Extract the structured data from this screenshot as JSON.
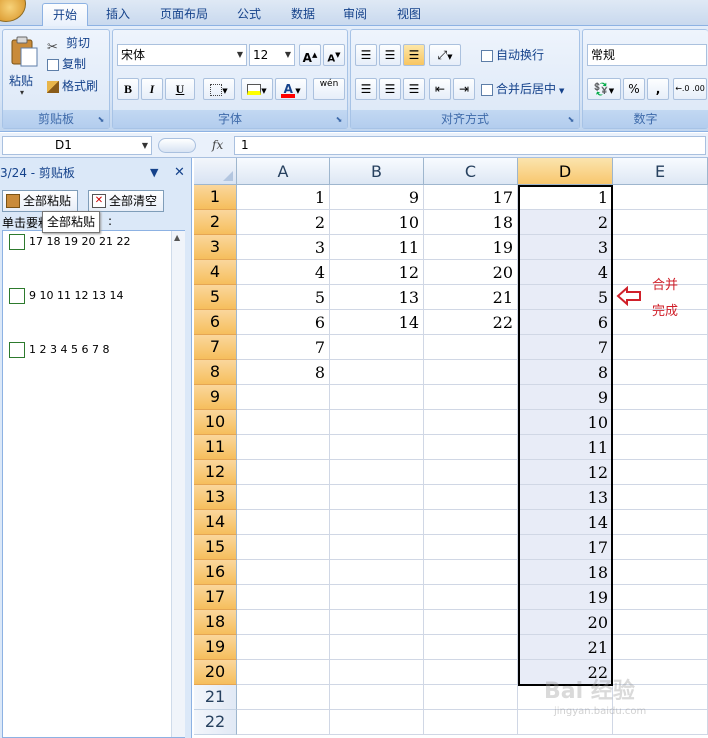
{
  "tabs": [
    {
      "label": "开始",
      "active": true
    },
    {
      "label": "插入"
    },
    {
      "label": "页面布局"
    },
    {
      "label": "公式"
    },
    {
      "label": "数据"
    },
    {
      "label": "审阅"
    },
    {
      "label": "视图"
    }
  ],
  "ribbon": {
    "clipboard": {
      "paste": "粘贴",
      "cut": "剪切",
      "copy": "复制",
      "format_painter": "格式刷",
      "label": "剪贴板"
    },
    "font": {
      "name": "宋体",
      "size": "12",
      "bold": "B",
      "italic": "I",
      "underline": "U",
      "grow": "A",
      "shrink": "A",
      "label": "字体",
      "phonetic": "wén"
    },
    "alignment": {
      "wrap": "自动换行",
      "merge": "合并后居中",
      "label": "对齐方式"
    },
    "number": {
      "format": "常规",
      "percent": "%",
      "comma": ",",
      "label": "数字"
    }
  },
  "formula_bar": {
    "name_box": "D1",
    "fx": "fx",
    "value": "1"
  },
  "clipboard_pane": {
    "title": "3/24 - 剪贴板",
    "paste_all": "全部粘贴",
    "clear_all": "全部清空",
    "hint": "单击要粘",
    "hint_end": ":",
    "tooltip": "全部粘贴",
    "items": [
      "17 18 19 20 21 22",
      "9 10 11 12 13 14",
      "1 2 3 4 5 6 7 8"
    ]
  },
  "grid": {
    "columns": [
      "A",
      "B",
      "C",
      "D",
      "E"
    ],
    "selected_column": "D",
    "rows": [
      {
        "n": "1",
        "A": "1",
        "B": "9",
        "C": "17",
        "D": "1"
      },
      {
        "n": "2",
        "A": "2",
        "B": "10",
        "C": "18",
        "D": "2"
      },
      {
        "n": "3",
        "A": "3",
        "B": "11",
        "C": "19",
        "D": "3"
      },
      {
        "n": "4",
        "A": "4",
        "B": "12",
        "C": "20",
        "D": "4"
      },
      {
        "n": "5",
        "A": "5",
        "B": "13",
        "C": "21",
        "D": "5"
      },
      {
        "n": "6",
        "A": "6",
        "B": "14",
        "C": "22",
        "D": "6"
      },
      {
        "n": "7",
        "A": "7",
        "B": "",
        "C": "",
        "D": "7"
      },
      {
        "n": "8",
        "A": "8",
        "B": "",
        "C": "",
        "D": "8"
      },
      {
        "n": "9",
        "A": "",
        "B": "",
        "C": "",
        "D": "9"
      },
      {
        "n": "10",
        "A": "",
        "B": "",
        "C": "",
        "D": "10"
      },
      {
        "n": "11",
        "A": "",
        "B": "",
        "C": "",
        "D": "11"
      },
      {
        "n": "12",
        "A": "",
        "B": "",
        "C": "",
        "D": "12"
      },
      {
        "n": "13",
        "A": "",
        "B": "",
        "C": "",
        "D": "13"
      },
      {
        "n": "14",
        "A": "",
        "B": "",
        "C": "",
        "D": "14"
      },
      {
        "n": "15",
        "A": "",
        "B": "",
        "C": "",
        "D": "17"
      },
      {
        "n": "16",
        "A": "",
        "B": "",
        "C": "",
        "D": "18"
      },
      {
        "n": "17",
        "A": "",
        "B": "",
        "C": "",
        "D": "19"
      },
      {
        "n": "18",
        "A": "",
        "B": "",
        "C": "",
        "D": "20"
      },
      {
        "n": "19",
        "A": "",
        "B": "",
        "C": "",
        "D": "21"
      },
      {
        "n": "20",
        "A": "",
        "B": "",
        "C": "",
        "D": "22"
      },
      {
        "n": "21",
        "A": "",
        "B": "",
        "C": "",
        "D": ""
      },
      {
        "n": "22",
        "A": "",
        "B": "",
        "C": "",
        "D": ""
      }
    ]
  },
  "annotation": {
    "line1": "合并",
    "line2": "完成",
    "color": "#d0202a"
  },
  "watermark": {
    "text": "Bai 经验",
    "sub": "jingyan.baidu.com"
  }
}
